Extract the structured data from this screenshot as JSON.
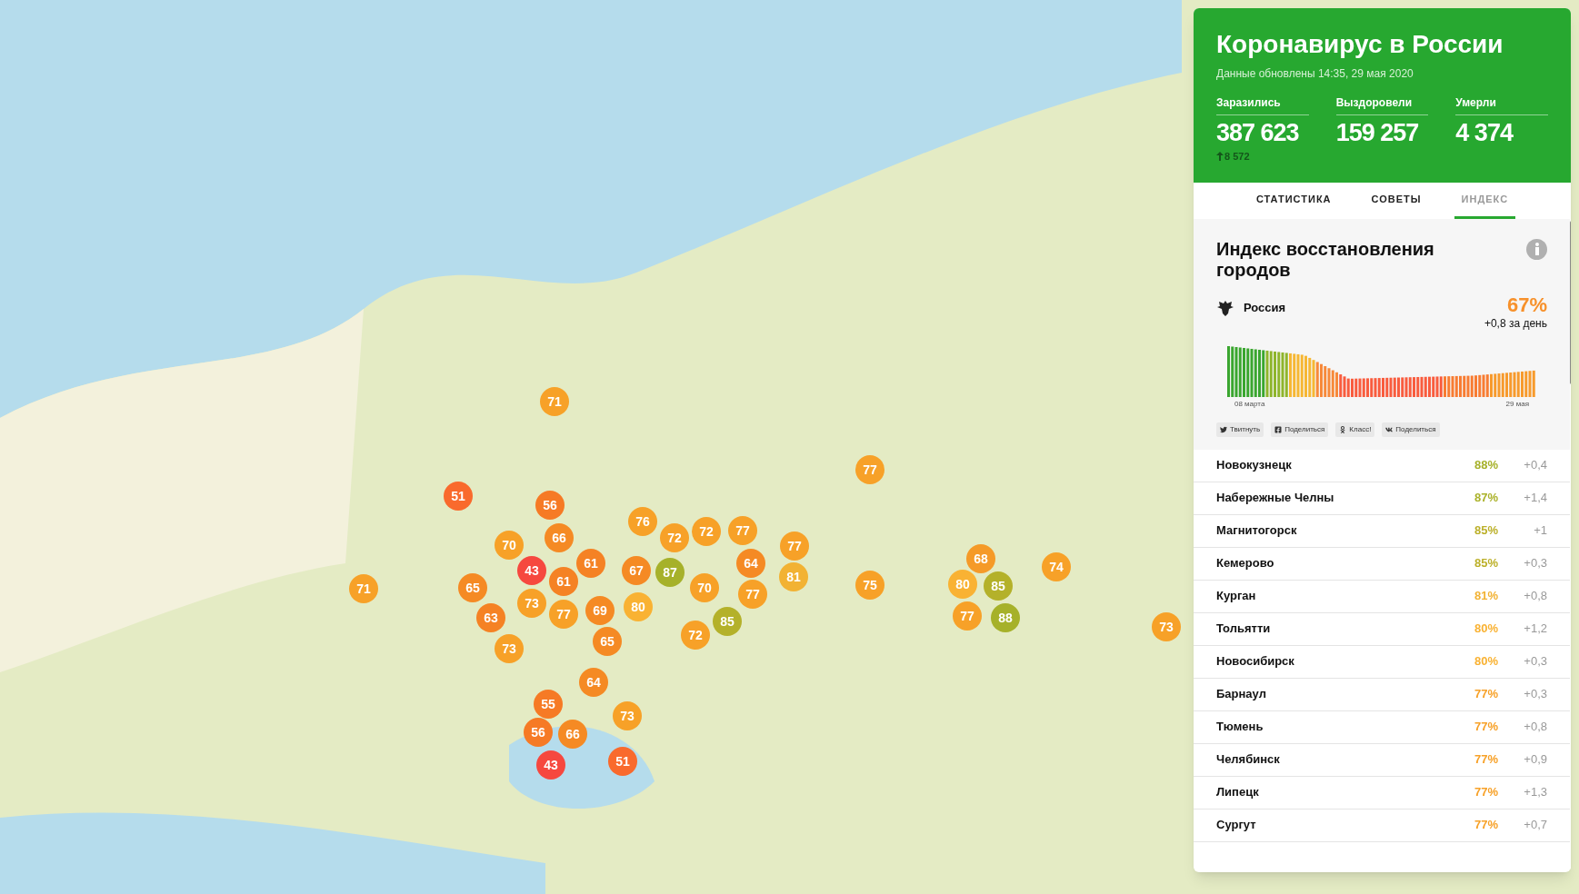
{
  "map": {
    "markers": [
      {
        "value": "71",
        "color": "#f7a128"
      },
      {
        "value": "77",
        "color": "#f7a128"
      },
      {
        "value": "51",
        "color": "#f96a2d"
      },
      {
        "value": "56",
        "color": "#f67a25"
      },
      {
        "value": "70",
        "color": "#f7a128"
      },
      {
        "value": "66",
        "color": "#f58a24"
      },
      {
        "value": "76",
        "color": "#f7a128"
      },
      {
        "value": "72",
        "color": "#f7a128"
      },
      {
        "value": "72",
        "color": "#f7a128"
      },
      {
        "value": "77",
        "color": "#f7a128"
      },
      {
        "value": "77",
        "color": "#f7a128"
      },
      {
        "value": "43",
        "color": "#f6483f"
      },
      {
        "value": "61",
        "color": "#f58224"
      },
      {
        "value": "67",
        "color": "#f58a24"
      },
      {
        "value": "87",
        "color": "#a6b12a"
      },
      {
        "value": "64",
        "color": "#f58a24"
      },
      {
        "value": "68",
        "color": "#f59a28"
      },
      {
        "value": "74",
        "color": "#f7a128"
      },
      {
        "value": "71",
        "color": "#f7a128"
      },
      {
        "value": "65",
        "color": "#f58a24"
      },
      {
        "value": "61",
        "color": "#f58224"
      },
      {
        "value": "70",
        "color": "#f7a128"
      },
      {
        "value": "77",
        "color": "#f7a128"
      },
      {
        "value": "81",
        "color": "#f2b233"
      },
      {
        "value": "75",
        "color": "#f7a128"
      },
      {
        "value": "80",
        "color": "#f9b233"
      },
      {
        "value": "85",
        "color": "#b4b12a"
      },
      {
        "value": "63",
        "color": "#f58224"
      },
      {
        "value": "73",
        "color": "#f7a128"
      },
      {
        "value": "77",
        "color": "#f7a128"
      },
      {
        "value": "69",
        "color": "#f58a24"
      },
      {
        "value": "80",
        "color": "#f9b233"
      },
      {
        "value": "85",
        "color": "#b4b12a"
      },
      {
        "value": "77",
        "color": "#f7a128"
      },
      {
        "value": "88",
        "color": "#a6b12a"
      },
      {
        "value": "73",
        "color": "#f7a128"
      },
      {
        "value": "73",
        "color": "#f7a128"
      },
      {
        "value": "65",
        "color": "#f58a24"
      },
      {
        "value": "72",
        "color": "#f7a128"
      },
      {
        "value": "64",
        "color": "#f58a24"
      },
      {
        "value": "55",
        "color": "#f67a25"
      },
      {
        "value": "73",
        "color": "#f7a128"
      },
      {
        "value": "56",
        "color": "#f67a25"
      },
      {
        "value": "66",
        "color": "#f58a24"
      },
      {
        "value": "43",
        "color": "#f6483f"
      },
      {
        "value": "51",
        "color": "#f96a2d"
      }
    ]
  },
  "panel": {
    "title": "Коронавирус в России",
    "updated": "Данные обновлены 14:35, 29 мая 2020",
    "stats": [
      {
        "label": "Заразились",
        "value": "387 623",
        "delta": "8 572"
      },
      {
        "label": "Выздоровели",
        "value": "159 257"
      },
      {
        "label": "Умерли",
        "value": "4 374"
      }
    ],
    "tabs": [
      {
        "label": "СТАТИСТИКА",
        "selected": false
      },
      {
        "label": "СОВЕТЫ",
        "selected": false
      },
      {
        "label": "ИНДЕКС",
        "selected": true
      }
    ],
    "index": {
      "title": "Индекс восстановления городов",
      "country": "Россия",
      "percent": "67%",
      "change": "+0,8 за день",
      "chart_start": "08 марта",
      "chart_end": "29 мая",
      "share": [
        {
          "kind": "twitter",
          "label": "Твитнуть"
        },
        {
          "kind": "facebook",
          "label": "Поделиться"
        },
        {
          "kind": "ok",
          "label": "Класс!"
        },
        {
          "kind": "vk",
          "label": "Поделиться"
        }
      ]
    },
    "cities": [
      {
        "name": "Новокузнецк",
        "percent": "88%",
        "delta": "+0,4",
        "color": "#a6b12a"
      },
      {
        "name": "Набережные Челны",
        "percent": "87%",
        "delta": "+1,4",
        "color": "#abb22a"
      },
      {
        "name": "Магнитогорск",
        "percent": "85%",
        "delta": "+1",
        "color": "#bcb02a"
      },
      {
        "name": "Кемерово",
        "percent": "85%",
        "delta": "+0,3",
        "color": "#bcb02a"
      },
      {
        "name": "Курган",
        "percent": "81%",
        "delta": "+0,8",
        "color": "#f2b233"
      },
      {
        "name": "Тольятти",
        "percent": "80%",
        "delta": "+1,2",
        "color": "#f9b233"
      },
      {
        "name": "Новосибирск",
        "percent": "80%",
        "delta": "+0,3",
        "color": "#f9b233"
      },
      {
        "name": "Барнаул",
        "percent": "77%",
        "delta": "+0,3",
        "color": "#f7a128"
      },
      {
        "name": "Тюмень",
        "percent": "77%",
        "delta": "+0,8",
        "color": "#f7a128"
      },
      {
        "name": "Челябинск",
        "percent": "77%",
        "delta": "+0,9",
        "color": "#f7a128"
      },
      {
        "name": "Липецк",
        "percent": "77%",
        "delta": "+1,3",
        "color": "#f7a128"
      },
      {
        "name": "Сургут",
        "percent": "77%",
        "delta": "+0,7",
        "color": "#f7a128"
      }
    ]
  }
}
